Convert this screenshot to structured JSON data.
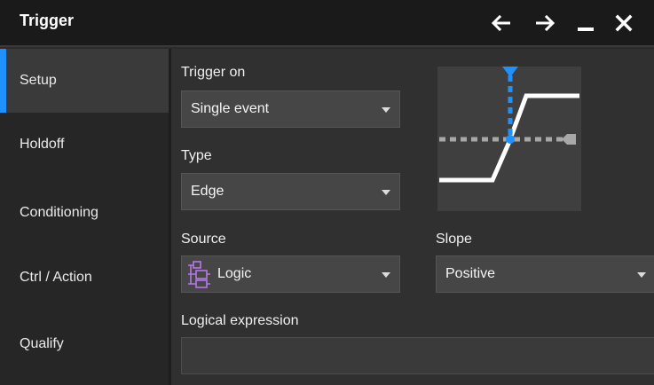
{
  "window": {
    "title": "Trigger",
    "controls": [
      {
        "name": "back-icon"
      },
      {
        "name": "forward-icon"
      },
      {
        "name": "minimize-icon"
      },
      {
        "name": "close-icon"
      }
    ]
  },
  "sidebar": {
    "active_item": "Setup",
    "items": [
      {
        "label": "Setup"
      },
      {
        "label": "Holdoff"
      },
      {
        "label": "Conditioning"
      },
      {
        "label": "Ctrl / Action"
      },
      {
        "label": "Qualify"
      }
    ]
  },
  "setup": {
    "trigger_on": {
      "label": "Trigger on",
      "value": "Single event"
    },
    "type": {
      "label": "Type",
      "value": "Edge"
    },
    "source": {
      "label": "Source",
      "value": "Logic",
      "icon": "logic-gates-icon"
    },
    "slope": {
      "label": "Slope",
      "value": "Positive"
    },
    "logical_expression": {
      "label": "Logical expression",
      "value": ""
    },
    "preview_icon": "positive-edge-trigger-icon"
  },
  "colors": {
    "accent": "#1e90ff",
    "logic_icon": "#b678e8",
    "titlebar_bg": "#1a1a1a",
    "panel_bg": "#303030",
    "field_bg": "#464646"
  }
}
